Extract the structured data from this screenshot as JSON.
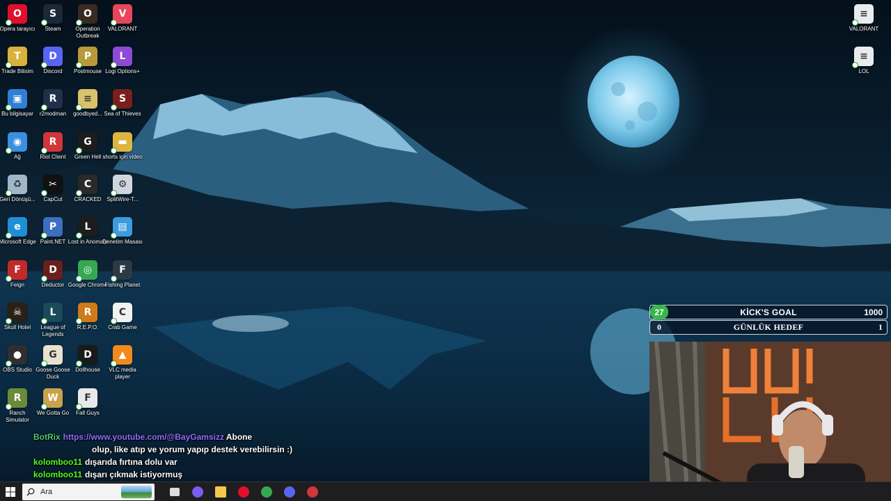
{
  "desktop": {
    "icons": [
      {
        "label": "Opera tarayıcı",
        "icon": "opera-icon",
        "color": "#e0102c",
        "glyph": "O"
      },
      {
        "label": "Steam",
        "icon": "steam-icon",
        "color": "#1b2838",
        "glyph": "S"
      },
      {
        "label": "Operation Outbreak",
        "icon": "operation-outbreak-icon",
        "color": "#3a2a22",
        "glyph": "O"
      },
      {
        "label": "VALORANT",
        "icon": "valorant-icon",
        "color": "#e8465a",
        "glyph": "V"
      },
      {
        "label": "Trade Bilisim",
        "icon": "trade-bilisim-icon",
        "color": "#d9b13b",
        "glyph": "T"
      },
      {
        "label": "Discord",
        "icon": "discord-icon",
        "color": "#5865f2",
        "glyph": "D"
      },
      {
        "label": "Postmouse",
        "icon": "postmouse-icon",
        "color": "#b89a3a",
        "glyph": "P"
      },
      {
        "label": "Logi Options+",
        "icon": "logi-options-icon",
        "color": "#8e4ad6",
        "glyph": "L"
      },
      {
        "label": "Bu bilgisayar",
        "icon": "this-pc-icon",
        "color": "#2f7fd6",
        "glyph": "▣"
      },
      {
        "label": "r2modman",
        "icon": "r2modman-icon",
        "color": "#20304a",
        "glyph": "R"
      },
      {
        "label": "goodbyed...",
        "icon": "text-file-icon",
        "color": "#d8c26a",
        "glyph": "≡"
      },
      {
        "label": "Sea of Thieves",
        "icon": "sea-of-thieves-icon",
        "color": "#7a1f1a",
        "glyph": "S"
      },
      {
        "label": "Ağ",
        "icon": "network-icon",
        "color": "#3a8fe0",
        "glyph": "◉"
      },
      {
        "label": "Riot Client",
        "icon": "riot-client-icon",
        "color": "#d13639",
        "glyph": "R"
      },
      {
        "label": "Green Hell",
        "icon": "green-hell-icon",
        "color": "#1c1c1c",
        "glyph": "G"
      },
      {
        "label": "shorts için video",
        "icon": "folder-icon",
        "color": "#e0b440",
        "glyph": "▬"
      },
      {
        "label": "Geri Dönüşü...",
        "icon": "recycle-bin-icon",
        "color": "#9fb7c9",
        "glyph": "♻"
      },
      {
        "label": "CapCut",
        "icon": "capcut-icon",
        "color": "#111111",
        "glyph": "✂"
      },
      {
        "label": "CRACKED",
        "icon": "cracked-icon",
        "color": "#2a2a2a",
        "glyph": "C"
      },
      {
        "label": "SplitWire-T...",
        "icon": "splitwire-icon",
        "color": "#cfd6dd",
        "glyph": "⚙"
      },
      {
        "label": "Microsoft Edge",
        "icon": "edge-icon",
        "color": "#1e8fd6",
        "glyph": "e"
      },
      {
        "label": "Paint.NET",
        "icon": "paint-net-icon",
        "color": "#3c6fc0",
        "glyph": "P"
      },
      {
        "label": "Lost in Anomaly",
        "icon": "lost-in-anomaly-icon",
        "color": "#1d1d1d",
        "glyph": "L"
      },
      {
        "label": "Denetim Masası",
        "icon": "control-panel-icon",
        "color": "#3d9be0",
        "glyph": "▤"
      },
      {
        "label": "Feign",
        "icon": "feign-icon",
        "color": "#c22a2a",
        "glyph": "F"
      },
      {
        "label": "Deductor",
        "icon": "deductor-icon",
        "color": "#6b1e1e",
        "glyph": "D"
      },
      {
        "label": "Google Chrome",
        "icon": "chrome-icon",
        "color": "#34a853",
        "glyph": "◎"
      },
      {
        "label": "Fishing Planet",
        "icon": "fishing-planet-icon",
        "color": "#2b3a44",
        "glyph": "F"
      },
      {
        "label": "Skull Hotel",
        "icon": "skull-hotel-icon",
        "color": "#2a2015",
        "glyph": "☠"
      },
      {
        "label": "League of Legends",
        "icon": "league-of-legends-icon",
        "color": "#1b4a5a",
        "glyph": "L"
      },
      {
        "label": "R.E.P.O.",
        "icon": "repo-icon",
        "color": "#d07a1a",
        "glyph": "R"
      },
      {
        "label": "Crab Game",
        "icon": "crab-game-icon",
        "color": "#f1f1f1",
        "glyph": "C"
      },
      {
        "label": "OBS Studio",
        "icon": "obs-studio-icon",
        "color": "#302e31",
        "glyph": "●"
      },
      {
        "label": "Goose Goose Duck",
        "icon": "goose-goose-duck-icon",
        "color": "#e8e2cf",
        "glyph": "G"
      },
      {
        "label": "Dollhouse",
        "icon": "dollhouse-icon",
        "color": "#1a1a1a",
        "glyph": "D"
      },
      {
        "label": "VLC media player",
        "icon": "vlc-icon",
        "color": "#f08a1c",
        "glyph": "▲"
      },
      {
        "label": "Ranch Simulator",
        "icon": "ranch-simulator-icon",
        "color": "#6b8a3a",
        "glyph": "R"
      },
      {
        "label": "We Gotta Go",
        "icon": "we-gotta-go-icon",
        "color": "#c9a24a",
        "glyph": "W"
      },
      {
        "label": "Fall Guys",
        "icon": "fall-guys-icon",
        "color": "#e9e9e9",
        "glyph": "F"
      }
    ],
    "right_icons": [
      {
        "label": "VALORANT",
        "icon": "text-file-icon",
        "color": "#e9ecef",
        "glyph": "≡"
      },
      {
        "label": "LOL",
        "icon": "text-file-icon",
        "color": "#e9ecef",
        "glyph": "≡"
      }
    ]
  },
  "goal_widget": {
    "row1": {
      "left": "27",
      "title": "KİCK'S GOAL",
      "right": "1000"
    },
    "row2": {
      "left": "0",
      "title": "GÜNLÜK HEDEF",
      "right": "1"
    }
  },
  "chat": [
    {
      "user": "BotRix",
      "link": "https://www.youtube.com/@BayGamsizz",
      "text": "Abone"
    },
    {
      "user": "",
      "link": "",
      "text": "olup, like atıp ve yorum yapıp destek verebilirsin :)"
    },
    {
      "user": "kolomboo11",
      "link": "",
      "text": "dışarıda fırtına dolu var"
    },
    {
      "user": "kolomboo11",
      "link": "",
      "text": "dışarı çıkmak istiyormuş"
    }
  ],
  "taskbar": {
    "search_placeholder": "Ara",
    "apps": [
      {
        "icon": "task-view-icon",
        "color": "#dddddd"
      },
      {
        "icon": "copilot-icon",
        "color": "#7b5cf0"
      },
      {
        "icon": "file-explorer-icon",
        "color": "#f2c94c"
      },
      {
        "icon": "opera-icon",
        "color": "#e0102c"
      },
      {
        "icon": "chrome-icon",
        "color": "#34a853"
      },
      {
        "icon": "discord-icon",
        "color": "#5865f2"
      },
      {
        "icon": "riot-client-icon",
        "color": "#d13639"
      }
    ]
  }
}
